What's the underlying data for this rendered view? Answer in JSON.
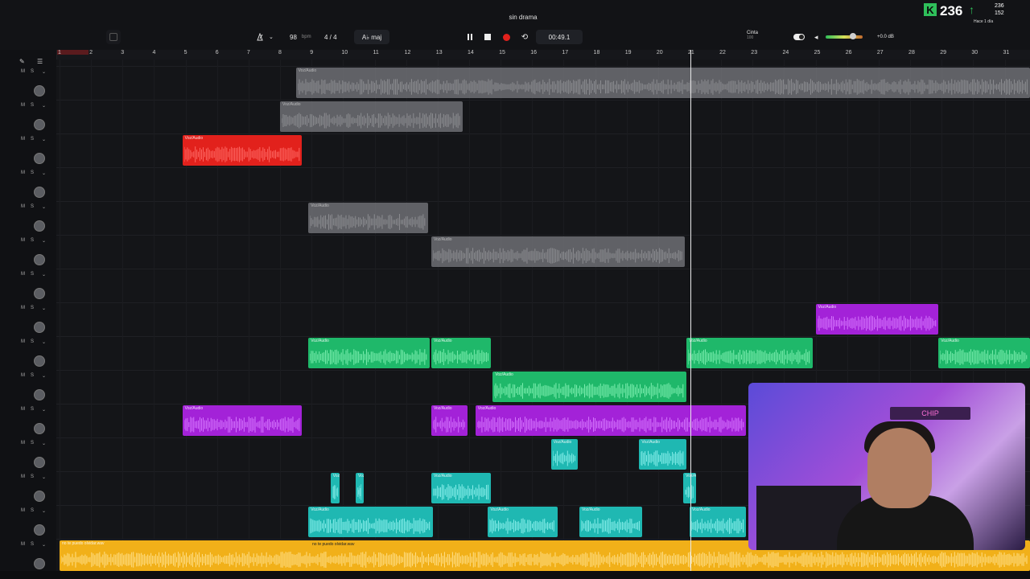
{
  "project": {
    "title": "sin drama"
  },
  "toolbar": {
    "bpm_value": "98",
    "bpm_unit": "bpm",
    "time_signature": "4 / 4",
    "key": "A♭ maj",
    "time_display": "00:49.1",
    "track_label": "Cinta",
    "track_sublabel": "100",
    "volume_readout": "+0.0 dB"
  },
  "stream_overlay": {
    "kick_count": "236",
    "count_a": "236",
    "count_b": "152",
    "subtitle": "Hace 1 día"
  },
  "ruler": {
    "bars": [
      "1",
      "2",
      "3",
      "4",
      "5",
      "6",
      "7",
      "8",
      "9",
      "10",
      "11",
      "12",
      "13",
      "14",
      "15",
      "16",
      "17",
      "18",
      "19",
      "20",
      "21",
      "22",
      "23",
      "24",
      "25",
      "26",
      "27",
      "28",
      "29",
      "30",
      "31"
    ]
  },
  "track_controls": {
    "mute": "M",
    "solo": "S"
  },
  "clips": {
    "default_label": "Voz/Audio",
    "bottom_label_1": "no te puedo olvidar.wav",
    "bottom_label_2": "no te puedo olvidar.wav"
  },
  "webcam": {
    "sign_text": "CHIP"
  },
  "colors": {
    "gray": "#7a7b80",
    "red": "#e2211c",
    "purple": "#a322d8",
    "green": "#1fb86a",
    "teal": "#1fb8b2",
    "yellow": "#f1b019",
    "record": "#e2211c",
    "accent": "#2fbf5a"
  },
  "icons": [
    "metronome-icon",
    "pause-icon",
    "stop-icon",
    "record-icon",
    "loop-icon",
    "speaker-icon",
    "pencil-icon",
    "kick-logo-icon",
    "arrow-up-icon"
  ]
}
